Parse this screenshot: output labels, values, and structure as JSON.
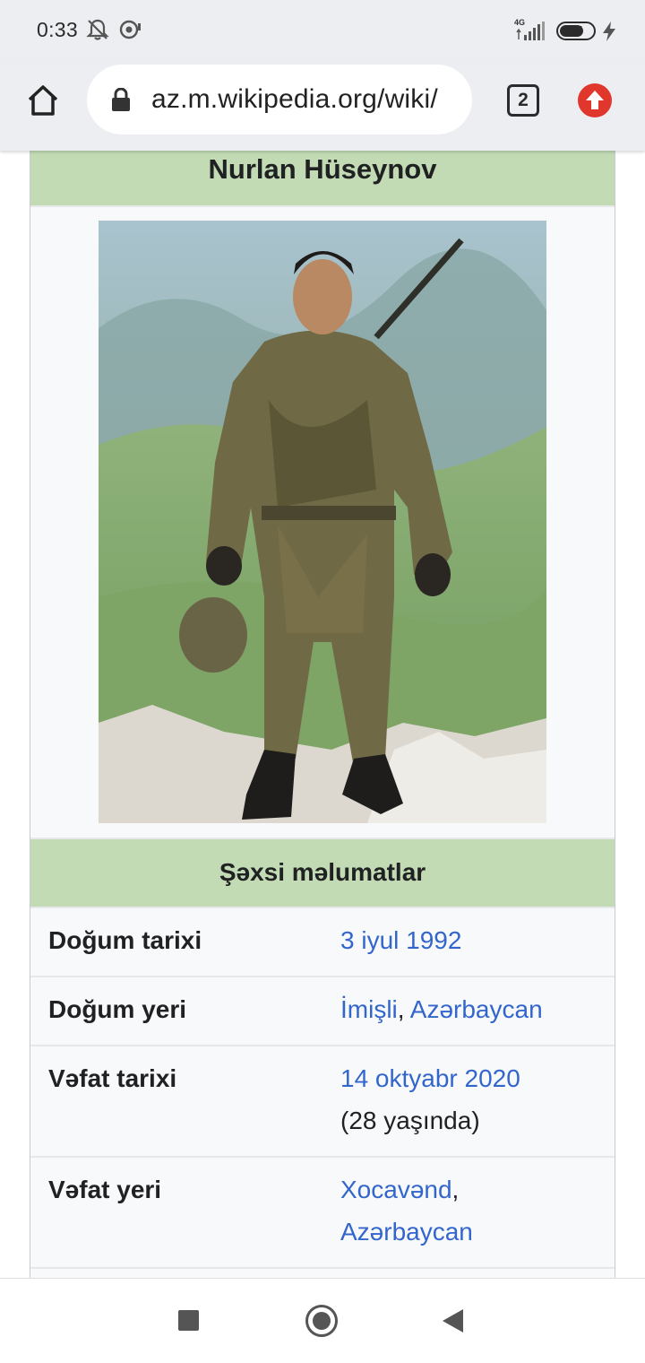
{
  "status_bar": {
    "time": "0:33",
    "network": "4G",
    "battery_level": "65",
    "icons": [
      "mute-notifications-icon",
      "notification-dot-icon",
      "signal-icon",
      "battery-icon",
      "charging-icon"
    ]
  },
  "browser": {
    "url": "az.m.wikipedia.org/wiki/",
    "tab_count": "2",
    "icons": [
      "home-icon",
      "lock-icon",
      "tabs-icon",
      "update-icon"
    ]
  },
  "infobox": {
    "title": "Nurlan Hüseynov",
    "photo_alt": "Portrait photo",
    "section": "Şəxsi məlumatlar",
    "rows": [
      {
        "label": "Doğum tarixi",
        "value_link": "3 iyul 1992"
      },
      {
        "label": "Doğum yeri",
        "value_link1": "İmişli",
        "sep": ",",
        "value_link2": "Azərbaycan"
      },
      {
        "label": "Vəfat tarixi",
        "value_link": "14 oktyabr 2020",
        "value_note": "(28 yaşında)"
      },
      {
        "label": "Vəfat yeri",
        "value_link1": "Xocavənd",
        "sep": ",",
        "value_link2": "Azərbaycan"
      }
    ]
  },
  "colors": {
    "header_green": "#c3dbb5",
    "link_blue": "#3366cc",
    "chrome_gray": "#eceef1",
    "update_red": "#e0362c"
  }
}
